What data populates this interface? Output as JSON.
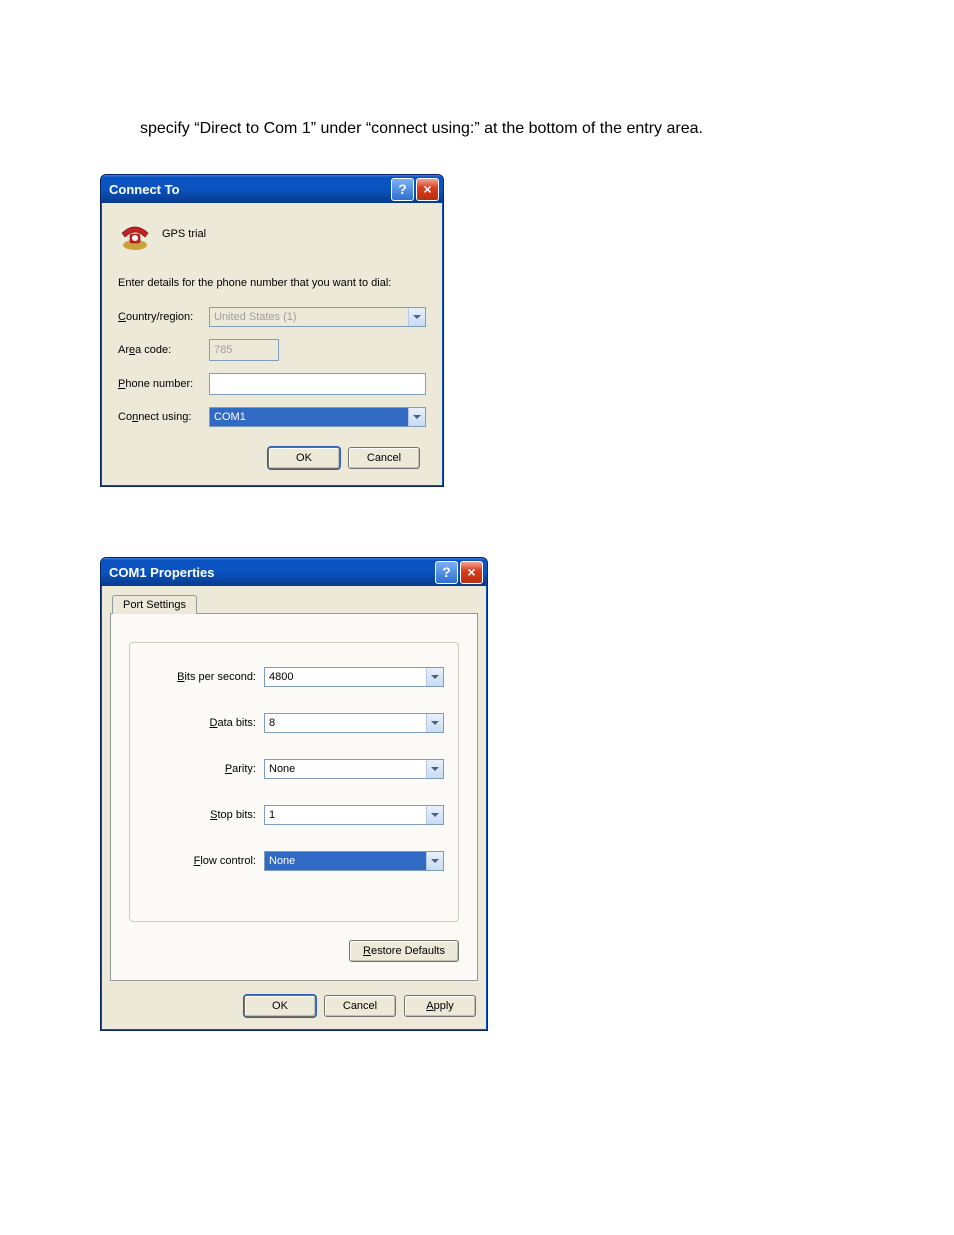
{
  "instruction_text": "specify “Direct to Com 1” under “connect using:” at the bottom of the entry area.",
  "dialog1": {
    "title": "Connect To",
    "help_btn": "?",
    "close_btn": "×",
    "connection_name": "GPS trial",
    "instruction": "Enter details for the phone number that you want to dial:",
    "labels": {
      "country": "Country/region:",
      "area": "Area code:",
      "phone": "Phone number:",
      "connect": "Connect using:"
    },
    "values": {
      "country": "United States (1)",
      "area": "785",
      "phone": "",
      "connect": "COM1"
    },
    "buttons": {
      "ok": "OK",
      "cancel": "Cancel"
    }
  },
  "dialog2": {
    "title": "COM1 Properties",
    "help_btn": "?",
    "close_btn": "×",
    "tab_label": "Port Settings",
    "labels": {
      "bps": "Bits per second:",
      "databits": "Data bits:",
      "parity": "Parity:",
      "stopbits": "Stop bits:",
      "flow": "Flow control:"
    },
    "values": {
      "bps": "4800",
      "databits": "8",
      "parity": "None",
      "stopbits": "1",
      "flow": "None"
    },
    "restore": "Restore Defaults",
    "buttons": {
      "ok": "OK",
      "cancel": "Cancel",
      "apply": "Apply"
    }
  }
}
